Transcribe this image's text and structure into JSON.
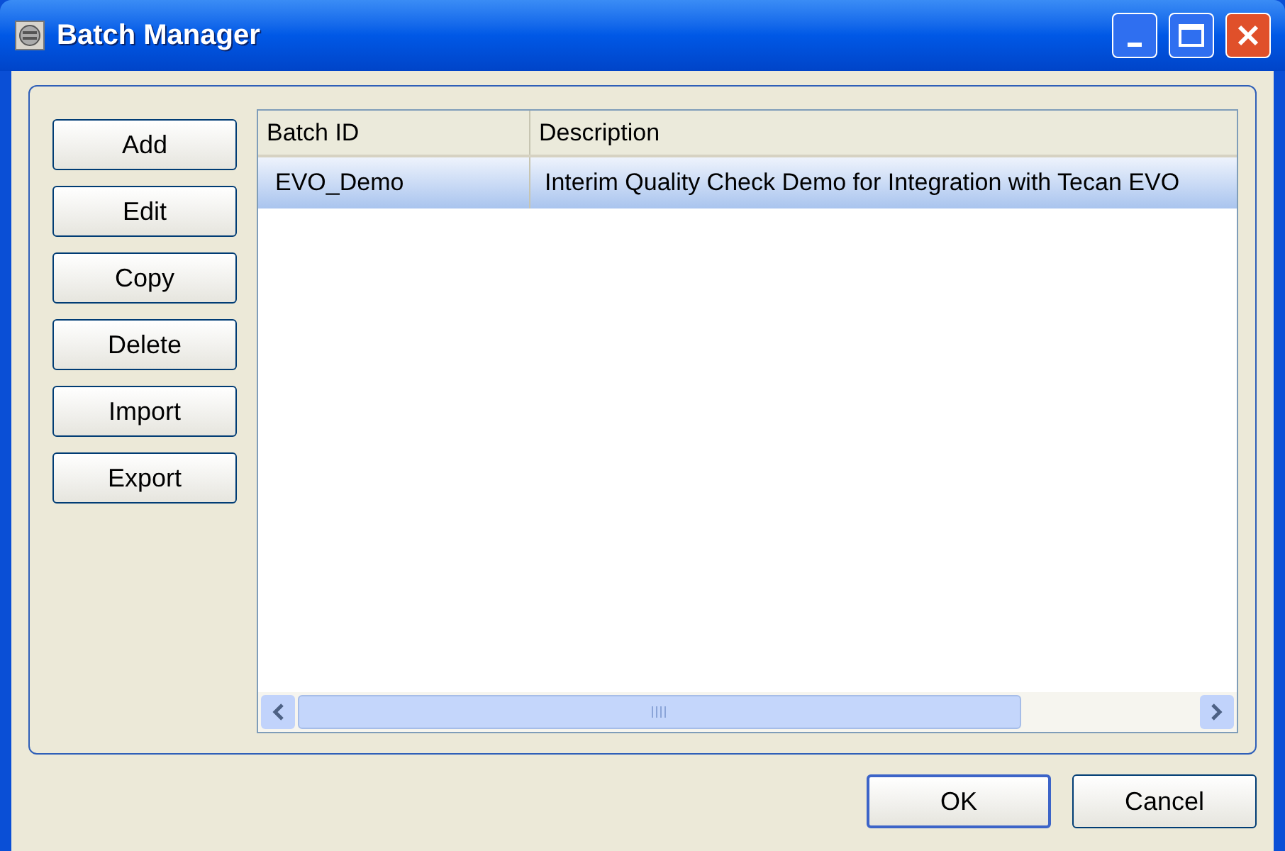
{
  "window": {
    "title": "Batch Manager"
  },
  "side_buttons": [
    "Add",
    "Edit",
    "Copy",
    "Delete",
    "Import",
    "Export"
  ],
  "table": {
    "columns": [
      "Batch ID",
      "Description"
    ],
    "rows": [
      {
        "cells": [
          "EVO_Demo",
          "Interim Quality Check Demo for Integration with Tecan EVO"
        ],
        "selected": true
      }
    ]
  },
  "buttons": [
    {
      "label": "OK",
      "default": true
    },
    {
      "label": "Cancel",
      "default": false
    }
  ]
}
